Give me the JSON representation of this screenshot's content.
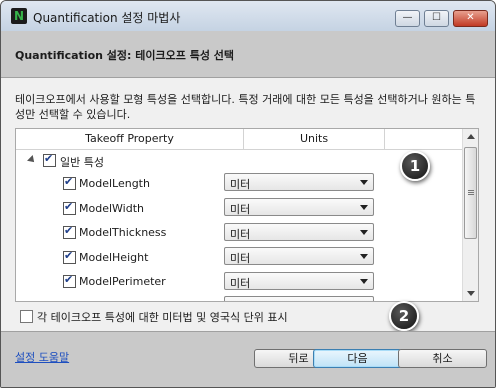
{
  "window": {
    "title": "Quantification 설정 마법사",
    "app_icon_letter": "N",
    "controls": {
      "minimize": "—",
      "maximize": "☐",
      "close": "✕"
    }
  },
  "header": {
    "title": "Quantification 설정: 테이크오프 특성 선택"
  },
  "description": "테이크오프에서 사용할 모형 특성을 선택합니다. 특정 거래에 대한 모든 특성을 선택하거나 원하는 특성만 선택할 수 있습니다.",
  "table": {
    "columns": [
      "Takeoff Property",
      "Units"
    ],
    "group": {
      "label": "일반 특성",
      "expanded": true,
      "checked": true
    },
    "rows": [
      {
        "name": "ModelLength",
        "checked": true,
        "unit": "미터"
      },
      {
        "name": "ModelWidth",
        "checked": true,
        "unit": "미터"
      },
      {
        "name": "ModelThickness",
        "checked": true,
        "unit": "미터"
      },
      {
        "name": "ModelHeight",
        "checked": true,
        "unit": "미터"
      },
      {
        "name": "ModelPerimeter",
        "checked": true,
        "unit": "미터"
      }
    ]
  },
  "callouts": [
    "1",
    "2"
  ],
  "show_units_checkbox": {
    "label": "각 테이크오프 특성에 대한 미터법 및 영국식 단위 표시",
    "checked": false
  },
  "footer": {
    "help_link": "설정 도움말",
    "back_button": "뒤로",
    "next_button": "다음",
    "cancel_button": "취소"
  },
  "colors": {
    "header_bg": "#c9c9c9",
    "link": "#1e4fbf",
    "close_button": "#c13a24",
    "primary_button_border": "#3c7fb1"
  }
}
